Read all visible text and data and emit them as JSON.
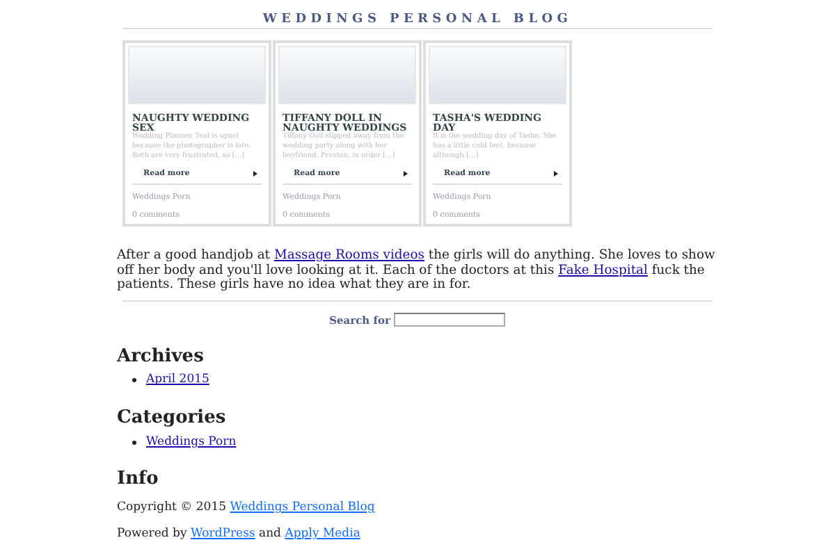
{
  "site_title": "WEDDINGS PERSONAL BLOG",
  "posts": [
    {
      "title": "NAUGHTY WEDDING SEX",
      "excerpt": "Wedding Planner Teal is upset because the photographer is late. Both are very frustrated, so [...]",
      "read_more": "Read more",
      "category": "Weddings Porn",
      "comments": "0 comments"
    },
    {
      "title": "TIFFANY DOLL IN NAUGHTY WEDDINGS",
      "excerpt": "Tiffany Doll slipped away from the wedding party along with her boyfriend, Preston, in order [...]",
      "read_more": "Read more",
      "category": "Weddings Porn",
      "comments": "0 comments"
    },
    {
      "title": "TASHA'S WEDDING DAY",
      "excerpt": "It is the wedding day of Tasha. She has a little cold feet, because although [...]",
      "read_more": "Read more",
      "category": "Weddings Porn",
      "comments": "0 comments"
    }
  ],
  "intro": [
    {
      "kind": "text",
      "text": "After a good handjob at "
    },
    {
      "kind": "link",
      "text": "Massage Rooms videos"
    },
    {
      "kind": "text",
      "text": " the girls will do anything. She loves to show off her body and you'll love looking at it. Each of the doctors at this "
    },
    {
      "kind": "link",
      "text": "Fake Hospital"
    },
    {
      "kind": "text",
      "text": " fuck the patients. These girls have no idea what they are in for."
    }
  ],
  "search": {
    "label": "Search for"
  },
  "sidebar": [
    {
      "heading": "Archives",
      "items": [
        "April 2015"
      ]
    },
    {
      "heading": "Categories",
      "items": [
        "Weddings Porn"
      ]
    }
  ],
  "info": {
    "heading": "Info",
    "lines": [
      [
        {
          "kind": "text",
          "text": "Copyright © 2015 "
        },
        {
          "kind": "link",
          "text": "Weddings Personal Blog"
        }
      ],
      [
        {
          "kind": "text",
          "text": "Powered by "
        },
        {
          "kind": "link",
          "text": "WordPress"
        },
        {
          "kind": "text",
          "text": " and "
        },
        {
          "kind": "link",
          "text": "Apply Media"
        }
      ]
    ]
  }
}
